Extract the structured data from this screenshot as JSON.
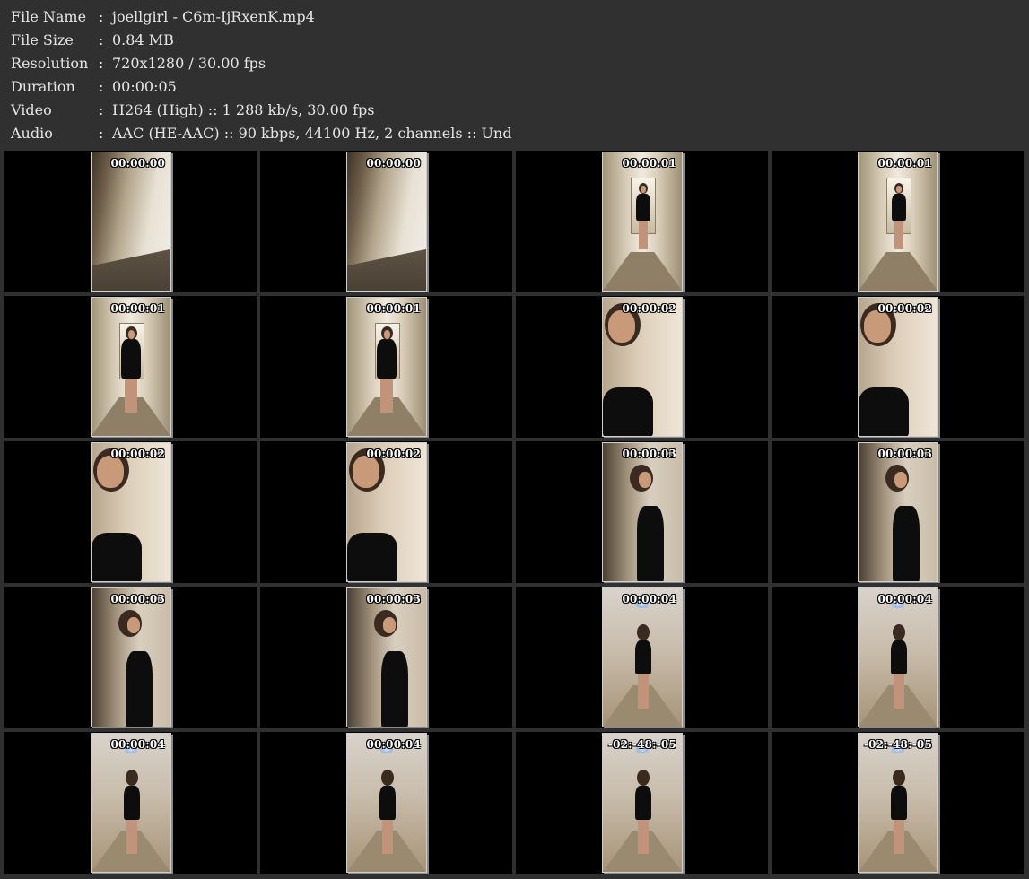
{
  "info": [
    {
      "key": "File Name",
      "sep": ":",
      "value": "joellgirl - C6m-IjRxenK.mp4"
    },
    {
      "key": "File Size",
      "sep": ":",
      "value": "0.84 MB"
    },
    {
      "key": "Resolution",
      "sep": ":",
      "value": "720x1280 / 30.00 fps"
    },
    {
      "key": "Duration",
      "sep": ":",
      "value": "00:00:05"
    },
    {
      "key": "Video",
      "sep": ":",
      "value": "H264 (High) :: 1 288 kb/s, 30.00 fps"
    },
    {
      "key": "Audio",
      "sep": ":",
      "value": "AAC (HE-AAC) :: 90 kbps, 44100 Hz, 2 channels :: Und"
    }
  ],
  "thumbnails": [
    {
      "time": "00:00:00",
      "scene": "wall"
    },
    {
      "time": "00:00:00",
      "scene": "wall"
    },
    {
      "time": "00:00:01",
      "scene": "hall-far"
    },
    {
      "time": "00:00:01",
      "scene": "hall-far"
    },
    {
      "time": "00:00:01",
      "scene": "hall-mid"
    },
    {
      "time": "00:00:01",
      "scene": "hall-mid"
    },
    {
      "time": "00:00:02",
      "scene": "close"
    },
    {
      "time": "00:00:02",
      "scene": "close"
    },
    {
      "time": "00:00:02",
      "scene": "close"
    },
    {
      "time": "00:00:02",
      "scene": "close"
    },
    {
      "time": "00:00:03",
      "scene": "turn"
    },
    {
      "time": "00:00:03",
      "scene": "turn"
    },
    {
      "time": "00:00:03",
      "scene": "turn"
    },
    {
      "time": "00:00:03",
      "scene": "turn"
    },
    {
      "time": "00:00:04",
      "scene": "away"
    },
    {
      "time": "00:00:04",
      "scene": "away"
    },
    {
      "time": "00:00:04",
      "scene": "away"
    },
    {
      "time": "00:00:04",
      "scene": "away"
    },
    {
      "time": "-02:-48:-05",
      "scene": "away"
    },
    {
      "time": "-02:-48:-05",
      "scene": "away"
    }
  ]
}
